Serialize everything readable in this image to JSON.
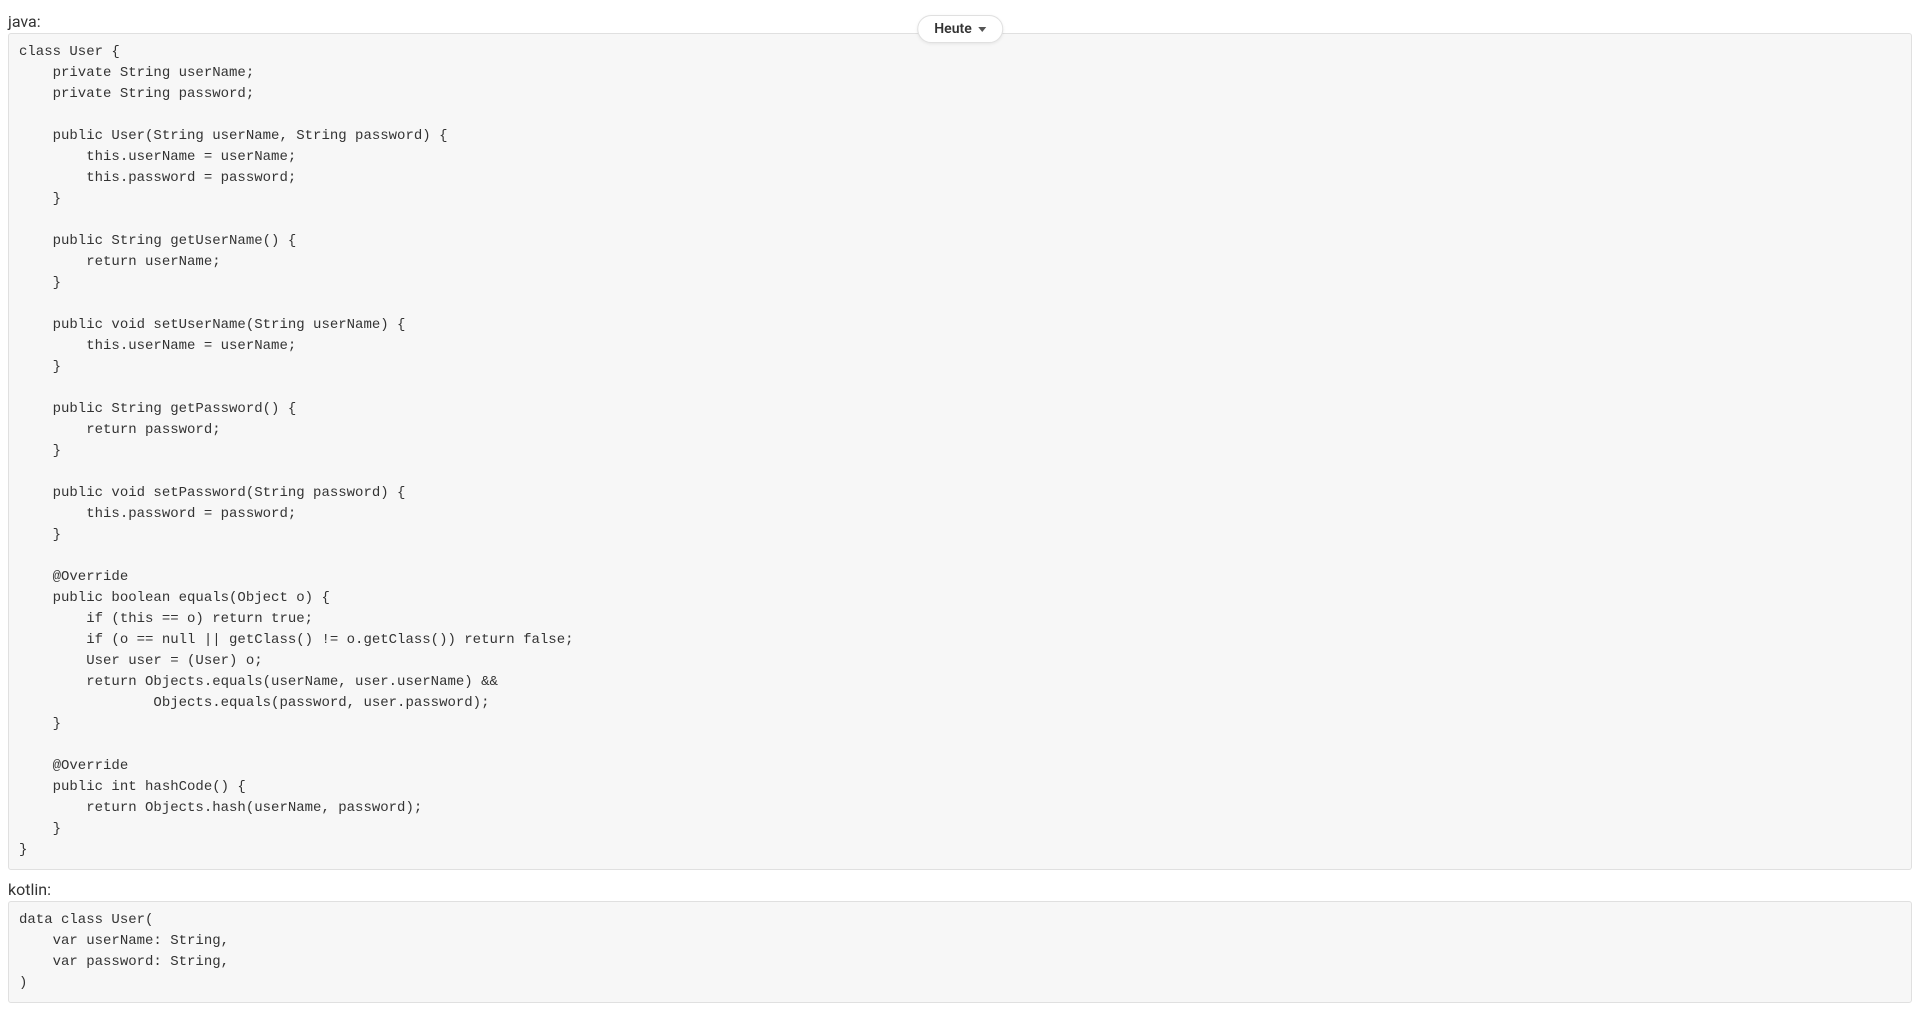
{
  "date_pill": {
    "label": "Heute"
  },
  "sections": {
    "java": {
      "label": "java:",
      "code": "class User {\n    private String userName;\n    private String password;\n\n    public User(String userName, String password) {\n        this.userName = userName;\n        this.password = password;\n    }\n\n    public String getUserName() {\n        return userName;\n    }\n\n    public void setUserName(String userName) {\n        this.userName = userName;\n    }\n\n    public String getPassword() {\n        return password;\n    }\n\n    public void setPassword(String password) {\n        this.password = password;\n    }\n\n    @Override\n    public boolean equals(Object o) {\n        if (this == o) return true;\n        if (o == null || getClass() != o.getClass()) return false;\n        User user = (User) o;\n        return Objects.equals(userName, user.userName) &&\n                Objects.equals(password, user.password);\n    }\n\n    @Override\n    public int hashCode() {\n        return Objects.hash(userName, password);\n    }\n}"
    },
    "kotlin": {
      "label": "kotlin:",
      "code": "data class User(\n    var userName: String,\n    var password: String,\n)"
    }
  }
}
